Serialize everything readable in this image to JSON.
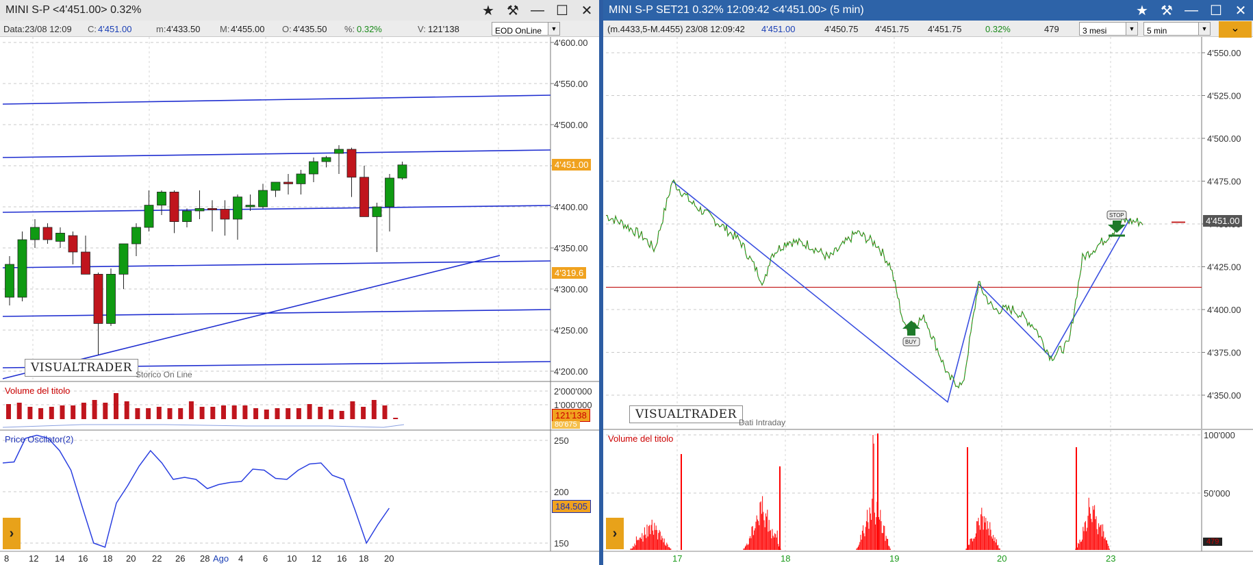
{
  "left": {
    "title": "MINI S-P <4'451.00> 0.32%",
    "info": {
      "data": "Data:23/08 12:09",
      "close_label": "C:",
      "close": "4'451.00",
      "min_label": "m:",
      "min": "4'433.50",
      "max_label": "M:",
      "max": "4'455.00",
      "open_label": "O:",
      "open": "4'435.50",
      "pct_label": "%:",
      "pct": "0.32%",
      "vol_label": "V:",
      "vol": "121'138",
      "mode": "EOD OnLine"
    },
    "price_axis": [
      "4'600.00",
      "4'550.00",
      "4'500.00",
      "4'450.00",
      "4'400.00",
      "4'350.00",
      "4'300.00",
      "4'250.00",
      "4'200.00"
    ],
    "last_price_tag": "4'451.00",
    "level_tag": "4'319.6",
    "logo": "VISUALTRADER",
    "logo_note": "Storico On Line",
    "volume_title": "Volume del titolo",
    "volume_axis": [
      "2'000'000",
      "1'000'000"
    ],
    "volume_tag": "121'138",
    "volume_tag2": "80'675",
    "osc_title": "Price Oscilator(2)",
    "osc_axis": [
      "250",
      "200",
      "150"
    ],
    "osc_tag": "184.505",
    "x_labels": [
      "8",
      "12",
      "14",
      "16",
      "18",
      "20",
      "22",
      "26",
      "28",
      "Ago",
      "4",
      "6",
      "10",
      "12",
      "16",
      "18",
      "20"
    ],
    "candles": [
      {
        "o": 4290,
        "h": 4340,
        "l": 4280,
        "c": 4330
      },
      {
        "o": 4290,
        "h": 4370,
        "l": 4285,
        "c": 4360
      },
      {
        "o": 4360,
        "h": 4385,
        "l": 4350,
        "c": 4375
      },
      {
        "o": 4375,
        "h": 4380,
        "l": 4355,
        "c": 4360
      },
      {
        "o": 4358,
        "h": 4375,
        "l": 4350,
        "c": 4368
      },
      {
        "o": 4365,
        "h": 4370,
        "l": 4330,
        "c": 4345
      },
      {
        "o": 4345,
        "h": 4365,
        "l": 4320,
        "c": 4318
      },
      {
        "o": 4318,
        "h": 4320,
        "l": 4220,
        "c": 4258
      },
      {
        "o": 4258,
        "h": 4325,
        "l": 4255,
        "c": 4318
      },
      {
        "o": 4318,
        "h": 4355,
        "l": 4300,
        "c": 4355
      },
      {
        "o": 4355,
        "h": 4380,
        "l": 4340,
        "c": 4375
      },
      {
        "o": 4375,
        "h": 4420,
        "l": 4370,
        "c": 4402
      },
      {
        "o": 4402,
        "h": 4420,
        "l": 4390,
        "c": 4418
      },
      {
        "o": 4418,
        "h": 4420,
        "l": 4368,
        "c": 4382
      },
      {
        "o": 4382,
        "h": 4398,
        "l": 4375,
        "c": 4395
      },
      {
        "o": 4395,
        "h": 4420,
        "l": 4385,
        "c": 4398
      },
      {
        "o": 4398,
        "h": 4408,
        "l": 4370,
        "c": 4397
      },
      {
        "o": 4397,
        "h": 4408,
        "l": 4365,
        "c": 4385
      },
      {
        "o": 4385,
        "h": 4415,
        "l": 4360,
        "c": 4412
      },
      {
        "o": 4400,
        "h": 4415,
        "l": 4395,
        "c": 4402
      },
      {
        "o": 4400,
        "h": 4428,
        "l": 4398,
        "c": 4420
      },
      {
        "o": 4420,
        "h": 4428,
        "l": 4412,
        "c": 4430
      },
      {
        "o": 4430,
        "h": 4440,
        "l": 4415,
        "c": 4428
      },
      {
        "o": 4428,
        "h": 4445,
        "l": 4415,
        "c": 4440
      },
      {
        "o": 4440,
        "h": 4460,
        "l": 4430,
        "c": 4455
      },
      {
        "o": 4455,
        "h": 4462,
        "l": 4448,
        "c": 4460
      },
      {
        "o": 4465,
        "h": 4475,
        "l": 4440,
        "c": 4470
      },
      {
        "o": 4470,
        "h": 4472,
        "l": 4412,
        "c": 4436
      },
      {
        "o": 4436,
        "h": 4450,
        "l": 4395,
        "c": 4388
      },
      {
        "o": 4388,
        "h": 4405,
        "l": 4345,
        "c": 4400
      },
      {
        "o": 4400,
        "h": 4440,
        "l": 4370,
        "c": 4435
      },
      {
        "o": 4435,
        "h": 4455,
        "l": 4433,
        "c": 4451
      }
    ],
    "volumes": [
      1.1,
      1.2,
      0.9,
      0.8,
      0.9,
      1.0,
      1.0,
      1.2,
      1.4,
      1.2,
      1.9,
      1.3,
      0.8,
      0.8,
      0.9,
      0.8,
      0.8,
      1.3,
      0.9,
      0.9,
      1.0,
      1.0,
      1.0,
      0.8,
      0.7,
      0.8,
      0.8,
      0.8,
      1.1,
      0.9,
      0.7,
      0.6,
      1.3,
      0.9,
      1.4,
      1.0,
      0.1
    ],
    "oscillator": [
      228,
      229,
      252,
      255,
      252,
      240,
      221,
      185,
      150,
      146,
      189,
      206,
      225,
      240,
      228,
      212,
      214,
      212,
      203,
      207,
      209,
      210,
      222,
      221,
      213,
      212,
      221,
      227,
      228,
      216,
      212,
      182,
      150,
      168,
      184
    ]
  },
  "right": {
    "title": "MINI S-P SET21 0.32% 12:09:42 <4'451.00> (5 min)",
    "info": {
      "range": "(m.4433,5-M.4455) 23/08 12:09:42",
      "last": "4'451.00",
      "v1": "4'450.75",
      "v2": "4'451.75",
      "v3": "4'451.75",
      "pct": "0.32%",
      "vol": "479",
      "period": "3 mesi",
      "interval": "5 min"
    },
    "price_axis": [
      "4'550.00",
      "4'525.00",
      "4'500.00",
      "4'475.00",
      "4'450.00",
      "4'425.00",
      "4'400.00",
      "4'375.00",
      "4'350.00"
    ],
    "last_price_tag": "4'451.00",
    "logo": "VISUALTRADER",
    "logo_note": "Dati Intraday",
    "buy_label": "BUY",
    "stop_label": "STOP",
    "volume_title": "Volume del titolo",
    "volume_axis": [
      "100'000",
      "50'000"
    ],
    "volume_tag": "479",
    "x_labels": [
      "17",
      "18",
      "19",
      "20",
      "23"
    ]
  }
}
